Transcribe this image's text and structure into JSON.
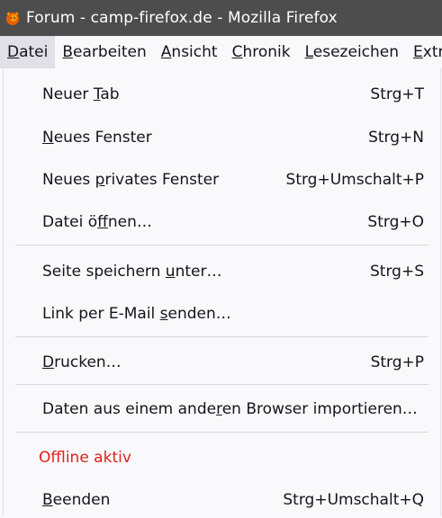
{
  "window": {
    "title": "Forum - camp-firefox.de - Mozilla Firefox",
    "icon": "firefox-icon"
  },
  "menubar": {
    "items": [
      {
        "pre": "",
        "key": "D",
        "post": "atei",
        "active": true
      },
      {
        "pre": "",
        "key": "B",
        "post": "earbeiten",
        "active": false
      },
      {
        "pre": "",
        "key": "A",
        "post": "nsicht",
        "active": false
      },
      {
        "pre": "",
        "key": "C",
        "post": "hronik",
        "active": false
      },
      {
        "pre": "",
        "key": "L",
        "post": "esezeichen",
        "active": false
      },
      {
        "pre": "",
        "key": "E",
        "post": "xtras",
        "active": false
      }
    ]
  },
  "file_menu": {
    "items": [
      {
        "pre": "Neuer ",
        "key": "T",
        "post": "ab",
        "shortcut": "Strg+T"
      },
      {
        "pre": "",
        "key": "N",
        "post": "eues Fenster",
        "shortcut": "Strg+N"
      },
      {
        "pre": "Neues ",
        "key": "p",
        "post": "rivates Fenster",
        "shortcut": "Strg+Umschalt+P"
      },
      {
        "pre": "Datei ö",
        "key": "f",
        "post": "fnen…",
        "shortcut": "Strg+O"
      },
      {
        "pre": "Seite speichern ",
        "key": "u",
        "post": "nter…",
        "shortcut": "Strg+S"
      },
      {
        "pre": "Link per E-Mail ",
        "key": "s",
        "post": "enden…",
        "shortcut": ""
      },
      {
        "pre": "",
        "key": "D",
        "post": "rucken…",
        "shortcut": "Strg+P"
      },
      {
        "pre": "Daten aus einem ande",
        "key": "r",
        "post": "en Browser importieren…",
        "shortcut": ""
      },
      {
        "pre": "Offline aktiv",
        "key": "",
        "post": "",
        "shortcut": ""
      },
      {
        "pre": "",
        "key": "B",
        "post": "eenden",
        "shortcut": "Strg+Umschalt+Q"
      }
    ],
    "offline_color": "#e0201c"
  }
}
